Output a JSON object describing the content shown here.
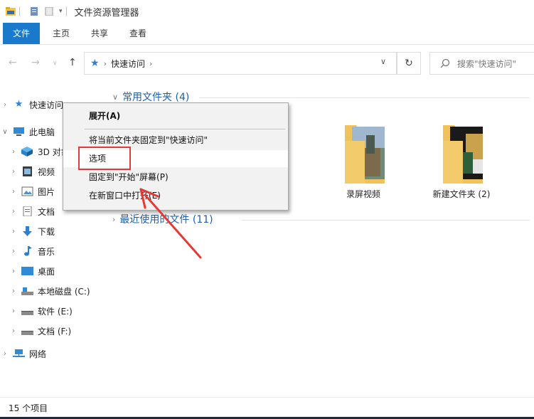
{
  "window": {
    "title": "文件资源管理器"
  },
  "ribbon": {
    "tabs": [
      "文件",
      "主页",
      "共享",
      "查看"
    ]
  },
  "address": {
    "path": [
      "快速访问"
    ],
    "search_placeholder": "搜索\"快速访问\""
  },
  "nav": {
    "items": [
      {
        "label": "快速访问",
        "icon": "star-icon"
      },
      {
        "label": "此电脑",
        "icon": "computer-icon"
      },
      {
        "label": "3D 对象",
        "icon": "3d-objects-icon"
      },
      {
        "label": "视频",
        "icon": "video-icon"
      },
      {
        "label": "图片",
        "icon": "pictures-icon"
      },
      {
        "label": "文档",
        "icon": "documents-icon"
      },
      {
        "label": "下载",
        "icon": "download-icon"
      },
      {
        "label": "音乐",
        "icon": "music-icon"
      },
      {
        "label": "桌面",
        "icon": "desktop-icon"
      },
      {
        "label": "本地磁盘 (C:)",
        "icon": "drive-icon"
      },
      {
        "label": "软件 (E:)",
        "icon": "drive-icon"
      },
      {
        "label": "文档 (F:)",
        "icon": "drive-icon"
      },
      {
        "label": "网络",
        "icon": "network-icon"
      }
    ]
  },
  "main": {
    "groups": [
      {
        "label": "常用文件夹 (4)"
      },
      {
        "label": "最近使用的文件 (11)"
      }
    ],
    "folders": [
      {
        "label": "录屏视频"
      },
      {
        "label": "新建文件夹 (2)"
      }
    ]
  },
  "context_menu": {
    "items": [
      "展开(A)",
      "将当前文件夹固定到\"快速访问\"",
      "选项",
      "固定到\"开始\"屏幕(P)",
      "在新窗口中打开(E)"
    ]
  },
  "status": {
    "text": "15 个项目"
  },
  "colors": {
    "accent": "#1979ca",
    "annotation": "#e53935"
  }
}
